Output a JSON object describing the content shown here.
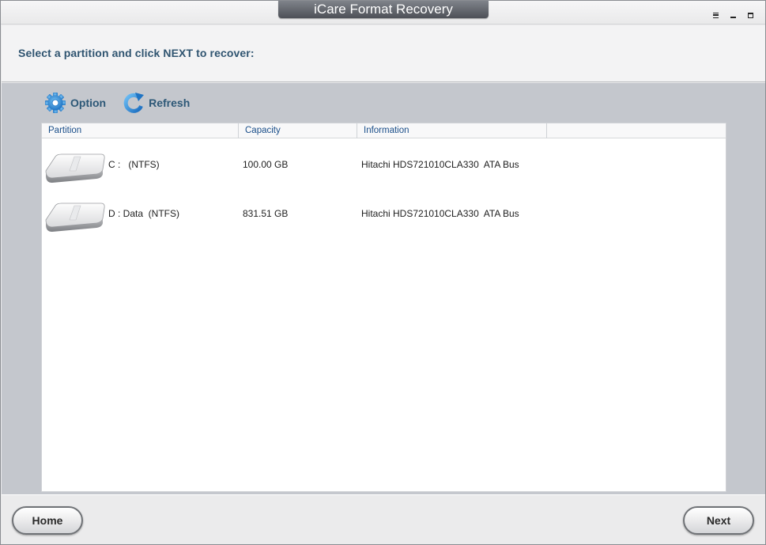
{
  "window": {
    "title": "iCare Format Recovery",
    "controls": {
      "menu": "menu-icon",
      "minimize": "minimize-icon",
      "maximize": "maximize-icon"
    }
  },
  "header": {
    "instruction": "Select a partition and click NEXT to recover:"
  },
  "toolbar": {
    "option_label": "Option",
    "refresh_label": "Refresh",
    "option_icon": "gear-icon",
    "refresh_icon": "refresh-icon"
  },
  "table": {
    "columns": [
      "Partition",
      "Capacity",
      "Information",
      ""
    ],
    "rows": [
      {
        "partition": "C :   (NTFS)",
        "capacity": "100.00 GB",
        "information": "Hitachi HDS721010CLA330  ATA Bus",
        "icon": "hard-drive-icon"
      },
      {
        "partition": "D : Data  (NTFS)",
        "capacity": "831.51 GB",
        "information": "Hitachi HDS721010CLA330  ATA Bus",
        "icon": "hard-drive-icon"
      }
    ]
  },
  "footer": {
    "home_label": "Home",
    "next_label": "Next"
  },
  "colors": {
    "accent": "#2f5470",
    "content_bg": "#c4c7cd",
    "column_header_text": "#1b4f8a",
    "title_tab": "#5a5e65"
  }
}
